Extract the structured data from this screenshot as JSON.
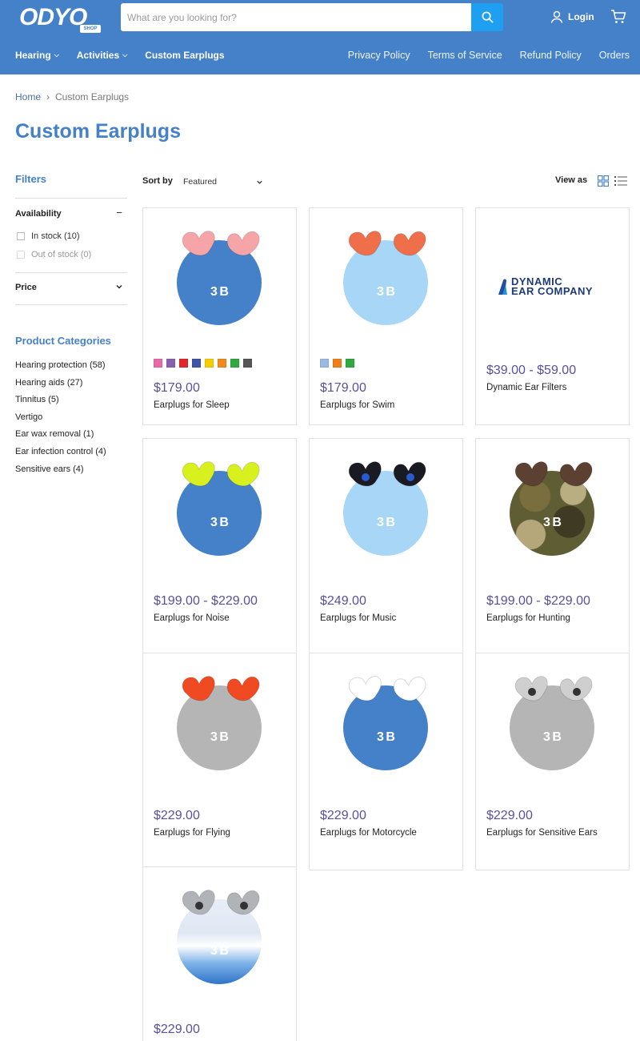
{
  "header": {
    "logo_text": "ODYO",
    "logo_sub": "SHOP",
    "search_placeholder": "What are you looking for?",
    "login_label": "Login"
  },
  "nav": {
    "left": [
      {
        "label": "Hearing",
        "has_caret": true
      },
      {
        "label": "Activities",
        "has_caret": true
      },
      {
        "label": "Custom Earplugs",
        "has_caret": false
      }
    ],
    "right": [
      {
        "label": "Privacy Policy"
      },
      {
        "label": "Terms of Service"
      },
      {
        "label": "Refund Policy"
      },
      {
        "label": "Orders"
      }
    ]
  },
  "breadcrumb": {
    "home": "Home",
    "separator": "›",
    "current": "Custom Earplugs"
  },
  "page_title": "Custom Earplugs",
  "sidebar": {
    "filters_title": "Filters",
    "availability": {
      "title": "Availability",
      "toggle": "−",
      "options": [
        {
          "label": "In stock (10)",
          "disabled": false
        },
        {
          "label": "Out of stock (0)",
          "disabled": true
        }
      ]
    },
    "price": {
      "title": "Price",
      "toggle": "⌄"
    },
    "categories_title": "Product Categories",
    "categories": [
      "Hearing protection (58)",
      "Hearing aids (27)",
      "Tinnitus (5)",
      "Vertigo",
      "Ear wax removal (1)",
      "Ear infection control (4)",
      "Sensitive ears (4)"
    ]
  },
  "toolbar": {
    "sort_label": "Sort by",
    "sort_value": "Featured",
    "view_label": "View as"
  },
  "products": [
    {
      "price": "$179.00",
      "name": "Earplugs for Sleep",
      "circle": "#4581c8",
      "plug": "#f5a5a8",
      "plug_style": "soft",
      "swatches": [
        "#e96aa8",
        "#8a5fb0",
        "#e3262c",
        "#3d55a3",
        "#f5cc00",
        "#f08a1c",
        "#2eaa3e",
        "#555555"
      ],
      "brand": "3 B"
    },
    {
      "price": "$179.00",
      "name": "Earplugs for Swim",
      "circle": "#a8d6f7",
      "plug": "#ef6f4a",
      "plug_style": "soft",
      "swatches": [
        "#9ab9e0",
        "#ef7f1a",
        "#2eaa3e"
      ],
      "brand": "3 B"
    },
    {
      "price": "$39.00 - $59.00",
      "name": "Dynamic Ear Filters",
      "logo": true,
      "logo_line1": "DYNAMIC",
      "logo_line2": "EAR COMPANY"
    },
    {
      "price": "$199.00 - $229.00",
      "name": "Earplugs for Noise",
      "circle": "#4581c8",
      "plug": "#d9f01f",
      "plug_style": "soft",
      "brand": "3 B"
    },
    {
      "price": "$249.00",
      "name": "Earplugs for Music",
      "circle": "#a8d6f7",
      "plug": "#1a1a22",
      "plug_style": "music",
      "brand": "3 B"
    },
    {
      "price": "$199.00 - $229.00",
      "name": "Earplugs for Hunting",
      "circle": "camo",
      "plug": "#5c4031",
      "plug_style": "soft",
      "brand": "3 B"
    },
    {
      "price": "$229.00",
      "name": "Earplugs for Flying",
      "circle": "#b5b5b5",
      "plug": "#f04a22",
      "plug_style": "soft",
      "brand": "3 B"
    },
    {
      "price": "$229.00",
      "name": "Earplugs for Motorcycle",
      "circle": "#4581c8",
      "plug": "#ffffff",
      "plug_style": "soft",
      "brand": "3 B"
    },
    {
      "price": "$229.00",
      "name": "Earplugs for Sensitive Ears",
      "circle": "#b5b5b5",
      "plug": "#cfcfcf",
      "plug_style": "music",
      "brand": "3 B"
    },
    {
      "price": "$229.00",
      "name": "",
      "circle": "teeth",
      "plug": "#b0b4b8",
      "plug_style": "music",
      "brand": "3 B"
    }
  ]
}
